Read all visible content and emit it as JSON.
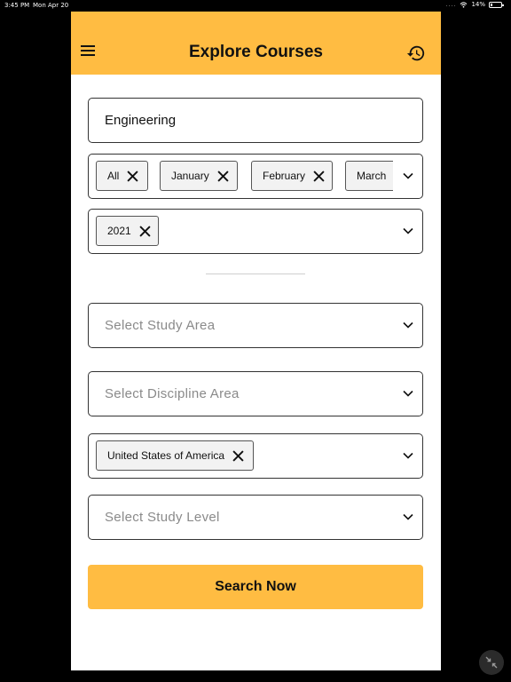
{
  "status_bar": {
    "time": "3:45 PM",
    "date": "Mon Apr 20",
    "signal": "....",
    "battery_text": "14%",
    "battery_level": 0.14
  },
  "header": {
    "title": "Explore Courses",
    "menu_icon": "hamburger-menu-icon",
    "history_icon": "history-icon",
    "background_color": "#ffbc42"
  },
  "search": {
    "value": "Engineering"
  },
  "months": {
    "chips": [
      "All",
      "January",
      "February",
      "March"
    ]
  },
  "years": {
    "chips": [
      "2021"
    ]
  },
  "study_area": {
    "placeholder": "Select Study Area"
  },
  "discipline_area": {
    "placeholder": "Select Discipline Area"
  },
  "countries": {
    "chips": [
      "United States of America"
    ]
  },
  "study_level": {
    "placeholder": "Select Study Level"
  },
  "search_button": {
    "label": "Search Now"
  },
  "floating_button": {
    "icon": "collapse-arrows-icon"
  }
}
